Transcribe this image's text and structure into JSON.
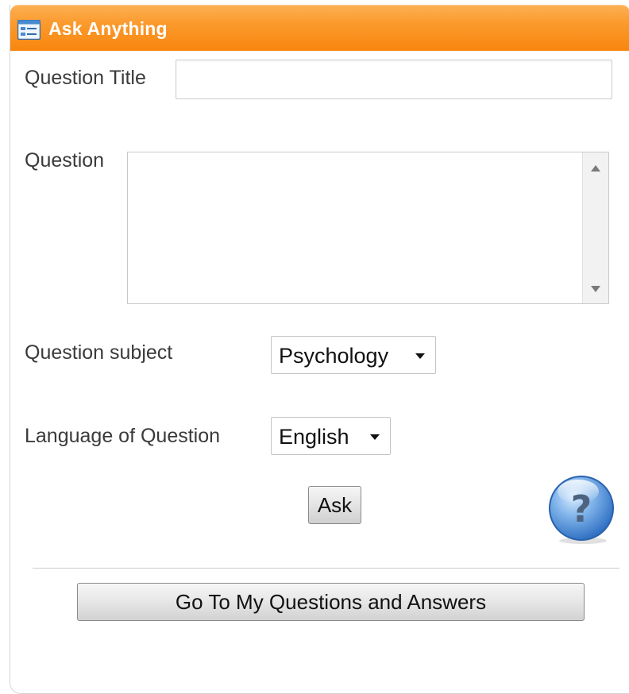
{
  "header": {
    "title": "Ask Anything",
    "icon": "form-window-icon",
    "color": "#f8860e"
  },
  "form": {
    "question_title": {
      "label": "Question Title",
      "value": "",
      "placeholder": ""
    },
    "question": {
      "label": "Question",
      "value": "",
      "placeholder": ""
    },
    "subject": {
      "label": "Question subject",
      "selected": "Psychology"
    },
    "language": {
      "label": "Language of Question",
      "selected": "English"
    },
    "ask_button": "Ask",
    "help_icon": "question-mark-icon"
  },
  "footer": {
    "my_qa_button": "Go To My Questions and Answers"
  }
}
